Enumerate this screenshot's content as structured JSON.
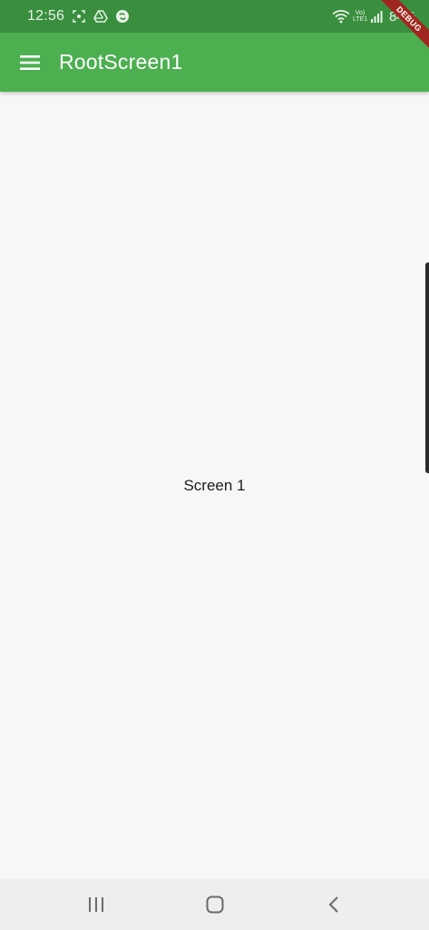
{
  "status_bar": {
    "time": "12:56",
    "icons": [
      "screenshot-icon",
      "drive-icon",
      "sync-app-icon"
    ],
    "right_icons": [
      "wifi-icon",
      "volte-icon",
      "signal-icon"
    ],
    "volte_line1": "Vo)",
    "volte_line2": "LTE1",
    "battery": "84%"
  },
  "app_bar": {
    "title": "RootScreen1",
    "menu_icon": "hamburger-menu-icon",
    "color": "#4caf50"
  },
  "debug_banner": "DEBUG",
  "body": {
    "text": "Screen 1"
  },
  "nav_bar": {
    "buttons": [
      "recent-apps-icon",
      "home-icon",
      "back-icon"
    ]
  },
  "colors": {
    "status_bar": "#3a8f3f",
    "app_bar": "#4caf50",
    "background": "#f8f7f8",
    "debug_ribbon": "#a0271f"
  }
}
